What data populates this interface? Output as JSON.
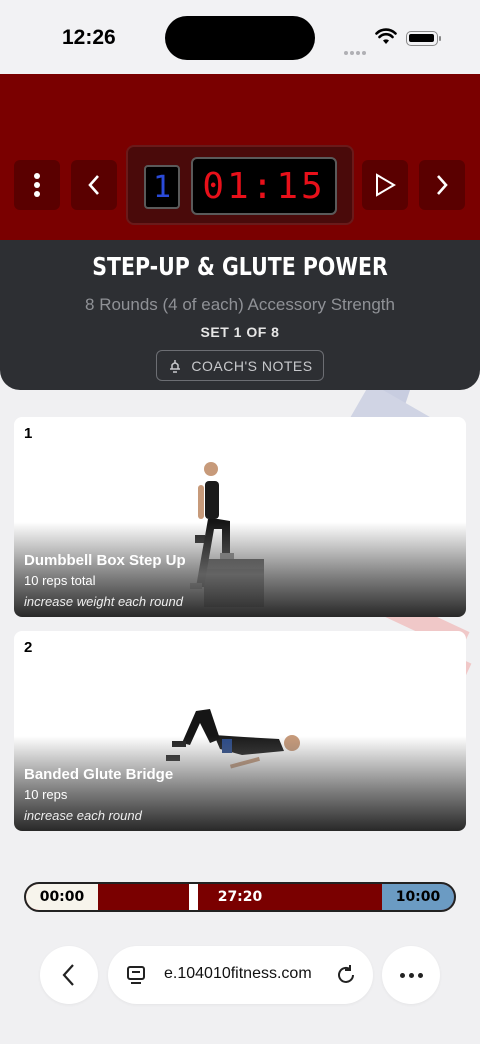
{
  "status_bar": {
    "time": "12:26"
  },
  "timer": {
    "round": "1",
    "clock": "01:15",
    "colors": {
      "header": "#7a0000",
      "clock_digits": "#e8101a",
      "round_digit": "#2a4ad8"
    }
  },
  "workout": {
    "title": "STEP-UP & GLUTE POWER",
    "subtitle": "8 Rounds (4 of each) Accessory Strength",
    "set_label": "SET 1 OF 8",
    "coach_notes_label": "COACH'S NOTES"
  },
  "exercises": [
    {
      "number": "1",
      "name": "Dumbbell Box Step Up",
      "reps": "10 reps total",
      "note": "increase weight each round"
    },
    {
      "number": "2",
      "name": "Banded Glute Bridge",
      "reps": "10 reps",
      "note": "increase each round"
    }
  ],
  "progress": {
    "start_label": "00:00",
    "current_label": "27:20",
    "end_label": "10:00",
    "position_fraction": 0.38
  },
  "browser": {
    "url": "e.104010fitness.com"
  },
  "icons": {
    "menu": "more-vertical-icon",
    "prev": "chevron-left-icon",
    "play": "play-icon",
    "next": "chevron-right-icon",
    "coach": "whistle-icon",
    "back": "back-arrow-icon",
    "tabs": "tab-overview-icon",
    "reload": "reload-icon",
    "more": "more-horizontal-icon"
  }
}
